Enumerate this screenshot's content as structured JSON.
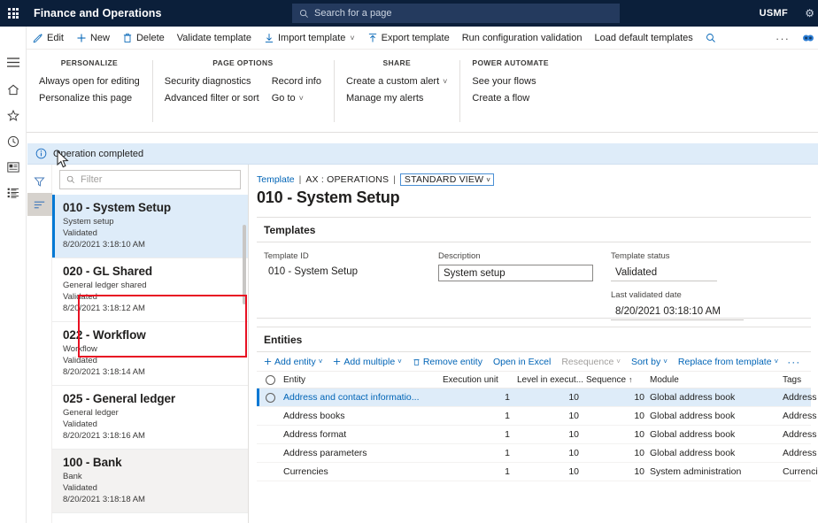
{
  "topbar": {
    "waffle_label": "app-launcher",
    "app_title": "Finance and Operations",
    "search_placeholder": "Search for a page",
    "company": "USMF"
  },
  "commandbar": {
    "buttons": [
      {
        "label": "Edit",
        "icon": "pencil-icon",
        "chevron": false
      },
      {
        "label": "New",
        "icon": "plus-icon",
        "chevron": false
      },
      {
        "label": "Delete",
        "icon": "trash-icon",
        "chevron": false
      },
      {
        "label": "Validate template",
        "icon": "",
        "chevron": false
      },
      {
        "label": "Import template",
        "icon": "import-icon",
        "chevron": true
      },
      {
        "label": "Export template",
        "icon": "export-icon",
        "chevron": false
      },
      {
        "label": "Run configuration validation",
        "icon": "",
        "chevron": false
      },
      {
        "label": "Load default templates",
        "icon": "",
        "chevron": false
      }
    ],
    "search_icon": "search-icon",
    "overflow": "···",
    "attach_icon": "view-icon"
  },
  "options_panel": {
    "groups": [
      {
        "title": "PERSONALIZE",
        "columns": [
          [
            {
              "label": "Always open for editing",
              "chevron": false
            },
            {
              "label": "Personalize this page",
              "chevron": false
            }
          ]
        ]
      },
      {
        "title": "PAGE OPTIONS",
        "columns": [
          [
            {
              "label": "Security diagnostics",
              "chevron": false
            },
            {
              "label": "Advanced filter or sort",
              "chevron": false
            }
          ],
          [
            {
              "label": "Record info",
              "chevron": false
            },
            {
              "label": "Go to",
              "chevron": true
            }
          ]
        ]
      },
      {
        "title": "SHARE",
        "columns": [
          [
            {
              "label": "Create a custom alert",
              "chevron": true
            },
            {
              "label": "Manage my alerts",
              "chevron": false
            }
          ]
        ]
      },
      {
        "title": "POWER AUTOMATE",
        "columns": [
          [
            {
              "label": "See your flows",
              "chevron": false
            },
            {
              "label": "Create a flow",
              "chevron": false
            }
          ]
        ]
      }
    ]
  },
  "navrail": {
    "items": [
      {
        "name": "hamburger-menu-icon"
      },
      {
        "name": "home-icon"
      },
      {
        "name": "favorites-star-icon"
      },
      {
        "name": "recent-clock-icon"
      },
      {
        "name": "workspaces-icon"
      },
      {
        "name": "modules-list-icon"
      }
    ]
  },
  "message_bar": {
    "icon": "info-icon",
    "text": "Operation completed"
  },
  "list_pane": {
    "tools": [
      {
        "name": "filter-funnel-icon",
        "selected": false
      },
      {
        "name": "sort-lines-icon",
        "selected": true
      }
    ],
    "filter_placeholder": "Filter",
    "items": [
      {
        "title": "010 - System Setup",
        "subtitle": "System setup",
        "status": "Validated",
        "date": "8/20/2021 3:18:10 AM",
        "state": "selected"
      },
      {
        "title": "020 - GL Shared",
        "subtitle": "General ledger shared",
        "status": "Validated",
        "date": "8/20/2021 3:18:12 AM",
        "state": "highlighted"
      },
      {
        "title": "022 - Workflow",
        "subtitle": "Workflow",
        "status": "Validated",
        "date": "8/20/2021 3:18:14 AM",
        "state": "normal"
      },
      {
        "title": "025 - General ledger",
        "subtitle": "General ledger",
        "status": "Validated",
        "date": "8/20/2021 3:18:16 AM",
        "state": "normal"
      },
      {
        "title": "100 - Bank",
        "subtitle": "Bank",
        "status": "Validated",
        "date": "8/20/2021 3:18:18 AM",
        "state": "hover"
      }
    ]
  },
  "content": {
    "breadcrumb": {
      "link": "Template",
      "sep": "|",
      "context": "AX : OPERATIONS",
      "view": "STANDARD VIEW"
    },
    "page_title": "010 - System Setup",
    "templates_section": {
      "heading": "Templates",
      "template_id": {
        "label": "Template ID",
        "value": "010 - System Setup"
      },
      "description": {
        "label": "Description",
        "value": "System setup"
      },
      "template_status": {
        "label": "Template status",
        "value": "Validated"
      },
      "last_validated": {
        "label": "Last validated date",
        "value": "8/20/2021 03:18:10 AM"
      }
    },
    "entities_section": {
      "heading": "Entities",
      "toolbar": [
        {
          "label": "Add entity",
          "icon": "plus-icon",
          "chevron": true,
          "disabled": false
        },
        {
          "label": "Add multiple",
          "icon": "plus-icon",
          "chevron": true,
          "disabled": false
        },
        {
          "label": "Remove entity",
          "icon": "trash-icon",
          "chevron": false,
          "disabled": false
        },
        {
          "label": "Open in Excel",
          "icon": "",
          "chevron": false,
          "disabled": false
        },
        {
          "label": "Resequence",
          "icon": "",
          "chevron": true,
          "disabled": true
        },
        {
          "label": "Sort by",
          "icon": "",
          "chevron": true,
          "disabled": false
        },
        {
          "label": "Replace from template",
          "icon": "",
          "chevron": true,
          "disabled": false
        }
      ],
      "toolbar_overflow": "···",
      "columns": {
        "entity": "Entity",
        "execution_unit": "Execution unit",
        "level": "Level in execut...",
        "sequence": "Sequence",
        "sequence_sort": "↑",
        "module": "Module",
        "tags": "Tags"
      },
      "rows": [
        {
          "entity": "Address and contact informatio...",
          "execution_unit": "1",
          "level": "10",
          "sequence": "10",
          "module": "Global address book",
          "tags": "Address setu",
          "selected": true
        },
        {
          "entity": "Address books",
          "execution_unit": "1",
          "level": "10",
          "sequence": "10",
          "module": "Global address book",
          "tags": "Address setu",
          "selected": false
        },
        {
          "entity": "Address format",
          "execution_unit": "1",
          "level": "10",
          "sequence": "10",
          "module": "Global address book",
          "tags": "Address setu",
          "selected": false
        },
        {
          "entity": "Address parameters",
          "execution_unit": "1",
          "level": "10",
          "sequence": "10",
          "module": "Global address book",
          "tags": "Address setu",
          "selected": false
        },
        {
          "entity": "Currencies",
          "execution_unit": "1",
          "level": "10",
          "sequence": "10",
          "module": "System administration",
          "tags": "Currencies",
          "selected": false
        }
      ]
    }
  },
  "colors": {
    "header_bg": "#0b1f3a",
    "search_bg": "#243a5e",
    "accent_blue": "#0078d4",
    "link_blue": "#0064b6",
    "selection_bg": "#deecf9",
    "annotation_red": "#e81123",
    "info_bar_bg": "#deecf9"
  }
}
